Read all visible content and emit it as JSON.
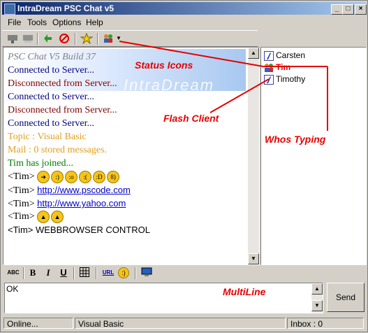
{
  "window": {
    "title": "IntraDream PSC Chat v5"
  },
  "menu": [
    "File",
    "Tools",
    "Options",
    "Help"
  ],
  "toolbar": {
    "icons": [
      "connect-icon",
      "disconnect-icon",
      "refresh-icon",
      "stop-icon",
      "favorite-star-icon",
      "users-dropdown-icon"
    ]
  },
  "banner": {
    "text": "IntraDream"
  },
  "chat": {
    "lines": [
      {
        "text": "PSC Chat V5 Build 37",
        "color": "#808080",
        "italic": true
      },
      {
        "text": "Connected to Server...",
        "color": "#000080"
      },
      {
        "text": "Disconnected from Server...",
        "color": "#800000"
      },
      {
        "text": "Connected to Server...",
        "color": "#000080"
      },
      {
        "text": "Disconnected from Server...",
        "color": "#800000"
      },
      {
        "text": "Connected to Server...",
        "color": "#000080"
      },
      {
        "text": "Topic : Visual Basic",
        "color": "#e0a020"
      },
      {
        "text": "Mail : 0 stored messages.",
        "color": "#e0a020"
      },
      {
        "text": "Tim has joined...",
        "color": "#008000"
      }
    ],
    "msgs": {
      "m1_prefix": "<Tim>",
      "m2_prefix": "<Tim>",
      "m2_link": "http://www.pscode.com",
      "m3_prefix": "<Tim>",
      "m3_link": "http://www.yahoo.com",
      "m4_prefix": "<Tim>",
      "m5": "<Tim> WEBBROWSER CONTROL"
    }
  },
  "users": [
    {
      "name": "Carsten",
      "active": false
    },
    {
      "name": "Tim",
      "active": true
    },
    {
      "name": "Timothy",
      "active": false
    }
  ],
  "format": {
    "abc": "ABC",
    "bold": "B",
    "italic": "I",
    "underline": "U",
    "url": "URL"
  },
  "input": {
    "value": "OK"
  },
  "send": {
    "label": "Send"
  },
  "status": {
    "left": "Online...",
    "middle": "Visual Basic",
    "right": "Inbox : 0"
  },
  "annotations": {
    "status_icons": "Status Icons",
    "flash_client": "Flash Client",
    "whos_typing": "Whos Typing",
    "multiline": "MultiLine"
  },
  "colors": {
    "accent": "#0a246a",
    "annotation": "#e60000"
  }
}
